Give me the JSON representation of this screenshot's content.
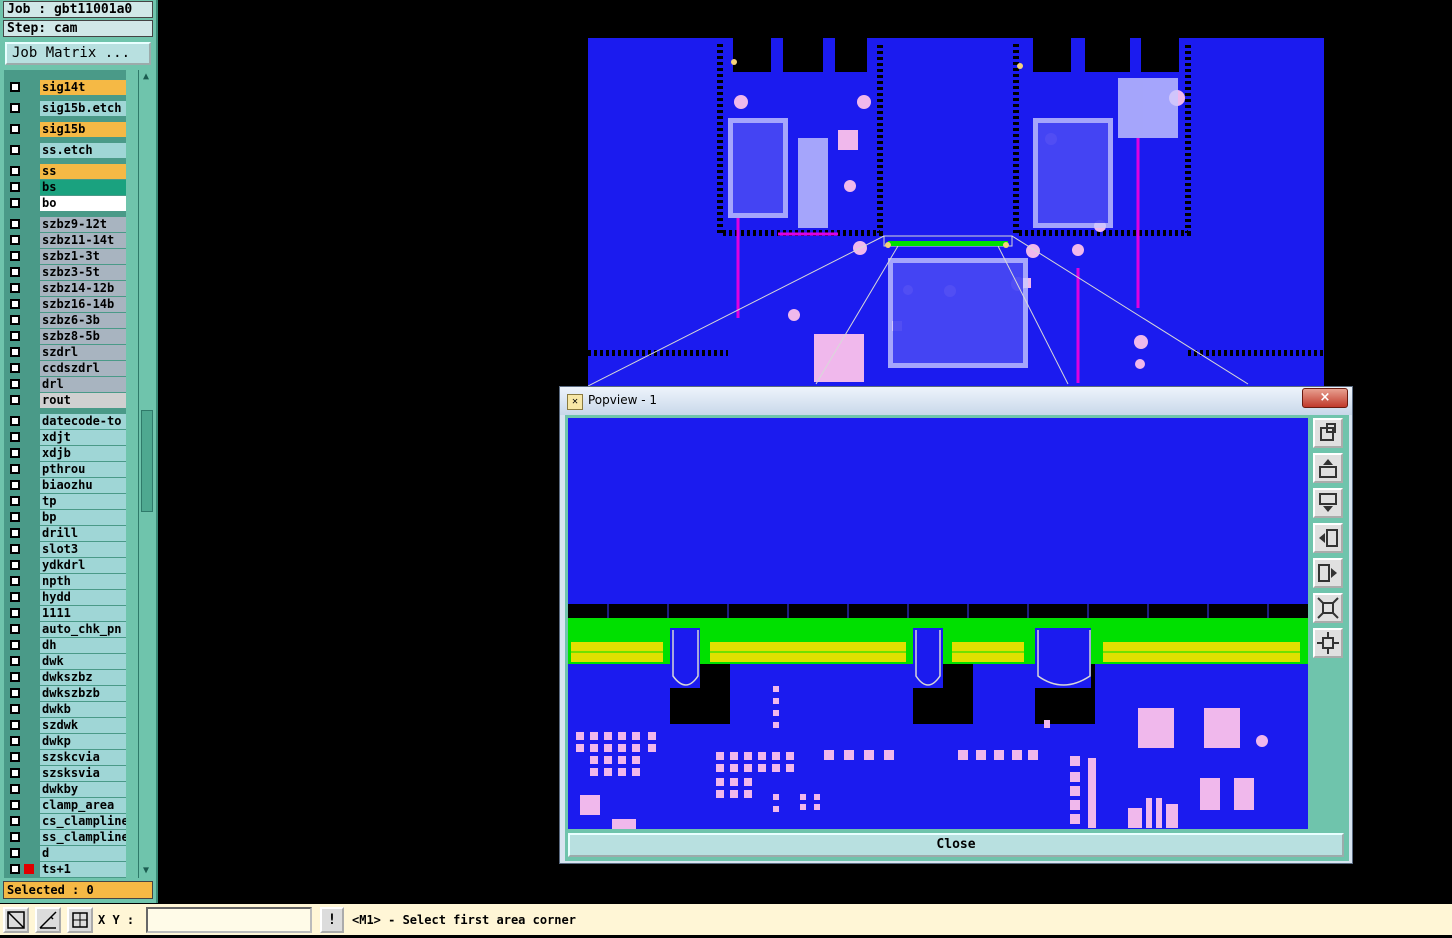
{
  "job": {
    "job_line": "Job : gbt11001a0",
    "step_line": "Step: cam",
    "matrix_button": "Job Matrix ..."
  },
  "layers": [
    {
      "name": "sig14t",
      "color": "#f5b945"
    },
    {
      "name": "sig15b.etch",
      "color": "#9fd6d6"
    },
    {
      "name": "sig15b",
      "color": "#f5b945"
    },
    {
      "name": "ss.etch",
      "color": "#9fd6d6"
    },
    {
      "name": "ss",
      "color": "#f5b945"
    },
    {
      "name": "bs",
      "color": "#1aa27f"
    },
    {
      "name": "bo",
      "color": "#ffffff"
    },
    {
      "name": "szbz9-12t",
      "color": "#a8b4c0"
    },
    {
      "name": "szbz11-14t",
      "color": "#a8b4c0"
    },
    {
      "name": "szbz1-3t",
      "color": "#a8b4c0"
    },
    {
      "name": "szbz3-5t",
      "color": "#a8b4c0"
    },
    {
      "name": "szbz14-12b",
      "color": "#a8b4c0"
    },
    {
      "name": "szbz16-14b",
      "color": "#a8b4c0"
    },
    {
      "name": "szbz6-3b",
      "color": "#a8b4c0"
    },
    {
      "name": "szbz8-5b",
      "color": "#a8b4c0"
    },
    {
      "name": "szdrl",
      "color": "#a8b4c0"
    },
    {
      "name": "ccdszdrl",
      "color": "#a8b4c0"
    },
    {
      "name": "drl",
      "color": "#a8b4c0"
    },
    {
      "name": "rout",
      "color": "#d0d0d0"
    },
    {
      "name": "datecode-to",
      "color": "#9fd6d6"
    },
    {
      "name": "xdjt",
      "color": "#9fd6d6"
    },
    {
      "name": "xdjb",
      "color": "#9fd6d6"
    },
    {
      "name": "pthrou",
      "color": "#9fd6d6"
    },
    {
      "name": "biaozhu",
      "color": "#9fd6d6"
    },
    {
      "name": "tp",
      "color": "#9fd6d6"
    },
    {
      "name": "bp",
      "color": "#9fd6d6"
    },
    {
      "name": "drill",
      "color": "#9fd6d6"
    },
    {
      "name": "slot3",
      "color": "#9fd6d6"
    },
    {
      "name": "ydkdrl",
      "color": "#9fd6d6"
    },
    {
      "name": "npth",
      "color": "#9fd6d6"
    },
    {
      "name": "hydd",
      "color": "#9fd6d6"
    },
    {
      "name": "1111",
      "color": "#9fd6d6"
    },
    {
      "name": "auto_chk_pn",
      "color": "#9fd6d6"
    },
    {
      "name": "dh",
      "color": "#9fd6d6"
    },
    {
      "name": "dwk",
      "color": "#9fd6d6"
    },
    {
      "name": "dwkszbz",
      "color": "#9fd6d6"
    },
    {
      "name": "dwkszbzb",
      "color": "#9fd6d6"
    },
    {
      "name": "dwkb",
      "color": "#9fd6d6"
    },
    {
      "name": "szdwk",
      "color": "#9fd6d6"
    },
    {
      "name": "dwkp",
      "color": "#9fd6d6"
    },
    {
      "name": "szskcvia",
      "color": "#9fd6d6"
    },
    {
      "name": "szsksvia",
      "color": "#9fd6d6"
    },
    {
      "name": "dwkby",
      "color": "#9fd6d6"
    },
    {
      "name": "clamp_area",
      "color": "#9fd6d6"
    },
    {
      "name": "cs_clampline",
      "color": "#9fd6d6"
    },
    {
      "name": "ss_clampline",
      "color": "#9fd6d6"
    },
    {
      "name": "d",
      "color": "#9fd6d6"
    },
    {
      "name": "ts+1",
      "color": "#9fd6d6",
      "red": true
    }
  ],
  "selected_label": "Selected : 0",
  "bottom": {
    "xy_label": "X Y :",
    "xy_value": "",
    "excl": "!",
    "prompt": "<M1> - Select first area corner"
  },
  "popup": {
    "title": "Popview - 1",
    "close_x": "×",
    "close_button": "Close"
  },
  "colors": {
    "board_bg": "#1b1bef",
    "pad": "#f0b8ec",
    "copper_green": "#00e000",
    "gold": "#e0e000",
    "panel_teal": "#6fc4ac"
  },
  "icons": {
    "toolbar": [
      "zoom-area-icon",
      "measure-icon",
      "grid-icon"
    ],
    "popview": [
      "zoom-in-icon",
      "pan-up-icon",
      "pan-down-icon",
      "pan-left-icon",
      "pan-right-icon",
      "fit-icon",
      "zoom-out-icon"
    ]
  }
}
